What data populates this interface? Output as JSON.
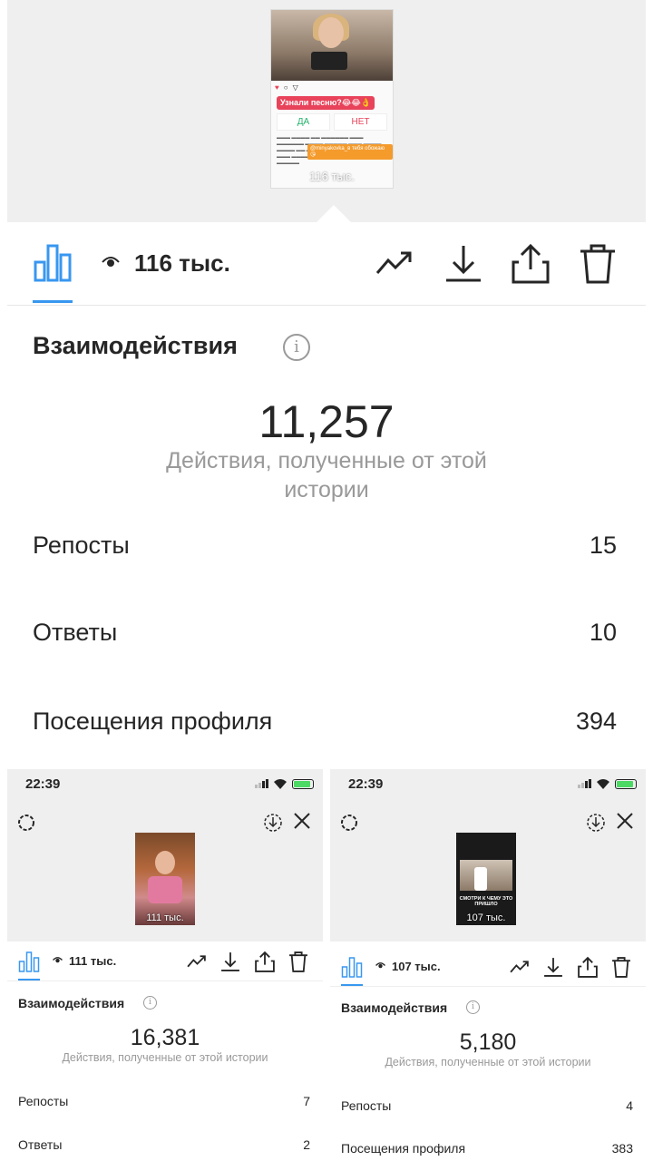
{
  "colors": {
    "accent": "#3897f0",
    "muted": "#999999",
    "panel_bg": "#efefef"
  },
  "main": {
    "story": {
      "question": "Узнали песню?😂😂👌",
      "yes": "ДА",
      "no": "НЕТ",
      "tag": "@minyakovka_в тебя обожаю😘",
      "views_overlay": "116 тыс."
    },
    "toolbar": {
      "views": "116 тыс.",
      "icons": [
        "stats-icon",
        "eye-icon",
        "trending-icon",
        "download-icon",
        "share-icon",
        "trash-icon"
      ]
    },
    "title": "Взаимодействия",
    "total": "11,257",
    "total_desc": "Действия, полученные от этой истории",
    "rows": [
      {
        "label": "Репосты",
        "value": "15"
      },
      {
        "label": "Ответы",
        "value": "10"
      },
      {
        "label": "Посещения профиля",
        "value": "394"
      }
    ]
  },
  "left_panel": {
    "time": "22:39",
    "thumb_views": "111 тыс.",
    "views": "111 тыс.",
    "title": "Взаимодействия",
    "total": "16,381",
    "total_desc": "Действия, полученные от этой истории",
    "rows": [
      {
        "label": "Репосты",
        "value": "7"
      },
      {
        "label": "Ответы",
        "value": "2"
      }
    ]
  },
  "right_panel": {
    "time": "22:39",
    "thumb_views": "107 тыс.",
    "thumb_caption": "СМОТРИ К ЧЕМУ ЭТО ПРИШЛО",
    "views": "107 тыс.",
    "title": "Взаимодействия",
    "total": "5,180",
    "total_desc": "Действия, полученные от этой истории",
    "rows": [
      {
        "label": "Репосты",
        "value": "4"
      },
      {
        "label": "Посещения профиля",
        "value": "383"
      }
    ]
  }
}
